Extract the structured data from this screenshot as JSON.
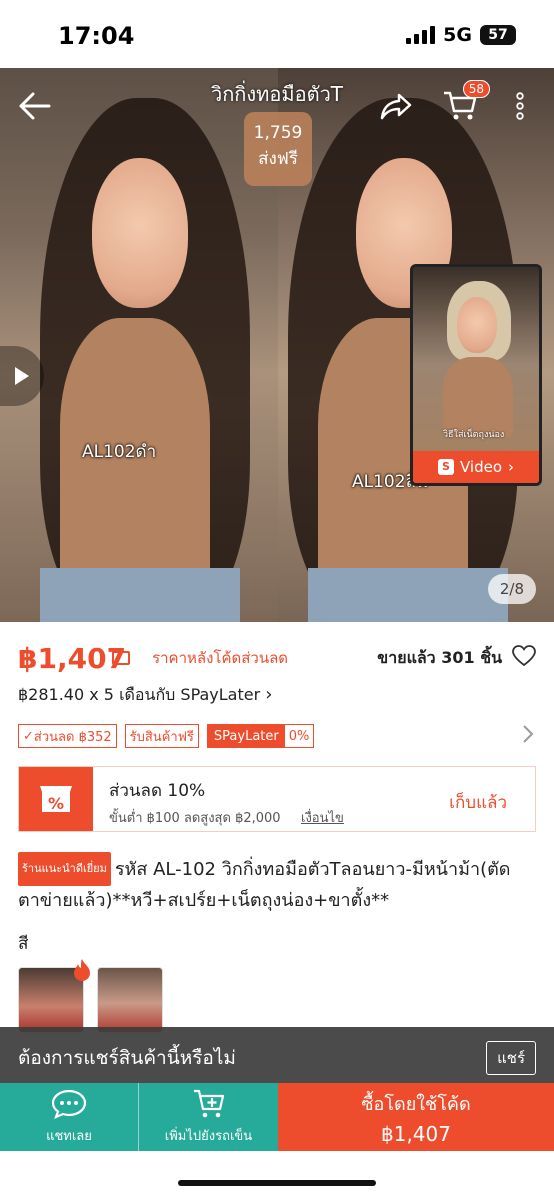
{
  "status_bar": {
    "time": "17:04",
    "network": "5G",
    "battery": "57"
  },
  "hero": {
    "title": "วิกกิ่งทอมือตัวT",
    "badge_count": "1,759",
    "badge_label": "ส่งฟรี",
    "cart_count": "58",
    "left_tag": "AL102ดำ",
    "right_tag": "AL102ลื่น",
    "video_label": "Video",
    "video_caption": "วิธีใส่เน็ตถุงน่อง",
    "image_counter": "2/8"
  },
  "price": {
    "amount": "฿1,407",
    "note": "ราคาหลังโค้ดส่วนลด",
    "sold": "ขายแล้ว 301 ชิ้น",
    "installment": "฿281.40 x 5 เดือนกับ SPayLater"
  },
  "tags": {
    "discount": "ส่วนลด ฿352",
    "free_pickup": "รับสินค้าฟรี",
    "spaylater": "SPayLater",
    "spaylater_rate": "0%"
  },
  "voucher": {
    "title": "ส่วนลด 10%",
    "details": "ขั้นต่ำ ฿100 ลดสูงสุด ฿2,000",
    "conditions": "เงื่อนไข",
    "action": "เก็บแล้ว"
  },
  "product": {
    "shop_badge": "ร้านแนะนำดีเยี่ยม",
    "title": "รหัส AL-102 วิกกิ่งทอมือตัวTลอนยาว-มีหน้าม้า(ตัดตาข่ายแล้ว)**หวี+สเปร์ย+เน็ตถุงน่อง+ขาตั้ง**",
    "color_label": "สี"
  },
  "share": {
    "text": "ต้องการแชร์สินค้านี้หรือไม่",
    "button": "แชร์"
  },
  "bottom": {
    "chat": "แชทเลย",
    "add_cart": "เพิ่มไปยังรถเข็น",
    "buy_label": "ซื้อโดยใช้โค้ด",
    "buy_price": "฿1,407"
  },
  "colors": {
    "brand": "#ee4d2d",
    "chat": "#26aa99"
  }
}
